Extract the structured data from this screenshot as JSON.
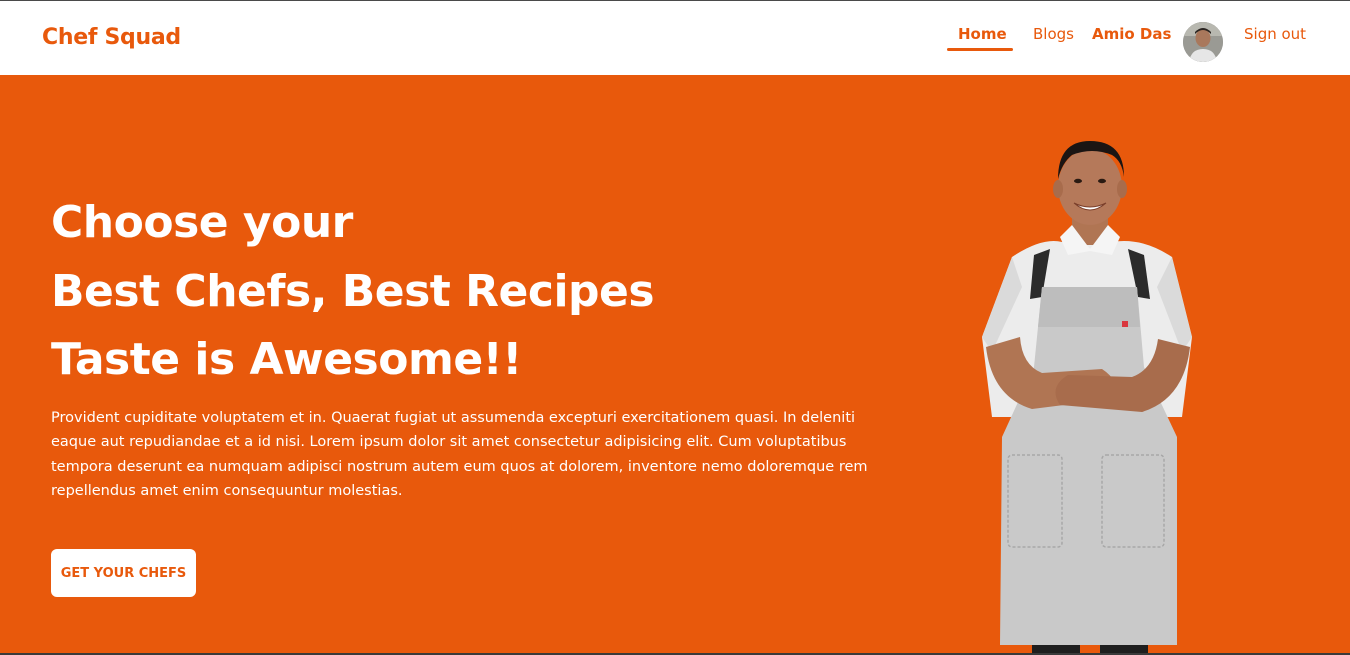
{
  "navbar": {
    "brand": "Chef Squad",
    "links": {
      "home": "Home",
      "blogs": "Blogs",
      "user": "Amio Das",
      "signout": "Sign out"
    }
  },
  "hero": {
    "headline_line1": "Choose your",
    "headline_line2": "Best Chefs, Best Recipes",
    "headline_line3": "Taste is Awesome!!",
    "description": "Provident cupiditate voluptatem et in. Quaerat fugiat ut assumenda excepturi exercitationem quasi. In deleniti eaque aut repudiandae et a id nisi. Lorem ipsum dolor sit amet consectetur adipisicing elit. Cum voluptatibus tempora deserunt ea numquam adipisci nostrum autem eum quos at dolorem, inventore nemo doloremque rem repellendus amet enim consequuntur molestias.",
    "cta_label": "GET YOUR CHEFS"
  },
  "colors": {
    "accent": "#e8590c",
    "background": "#ffffff",
    "text_on_accent": "#ffffff"
  }
}
